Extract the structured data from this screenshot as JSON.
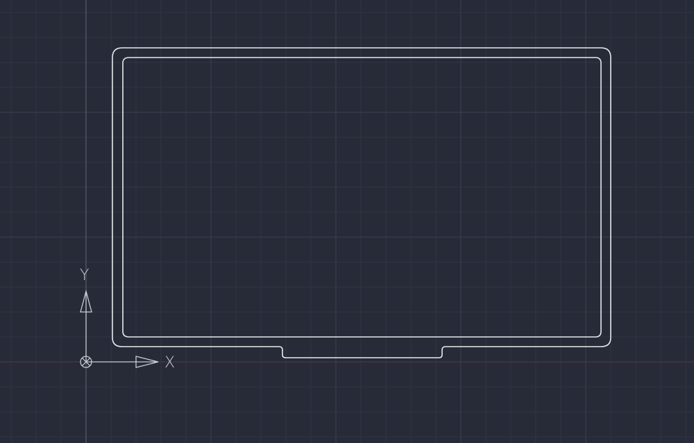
{
  "app": {
    "view": "cad-model-space",
    "background_color": "#262b37",
    "grid": true,
    "grid_minor_color": "#2f3543",
    "grid_major_color": "#3a4150",
    "object_color": "#e8eaee"
  },
  "ucs_icon": {
    "x_label": "X",
    "y_label": "Y"
  },
  "drawing_objects": [
    {
      "type": "outer-outline",
      "shape": "rounded-rectangle-with-bottom-tab"
    },
    {
      "type": "inner-offset-outline",
      "shape": "rounded-rectangle"
    }
  ]
}
